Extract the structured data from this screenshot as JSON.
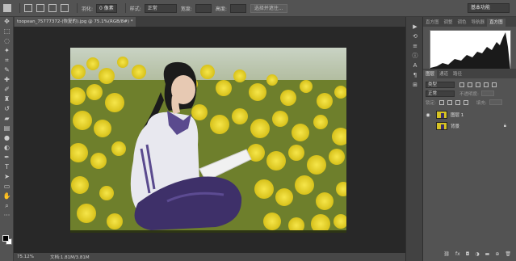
{
  "options_bar": {
    "feather_label": "羽化:",
    "feather_value": "0 像素",
    "style_label": "样式:",
    "style_value": "正常",
    "width_label": "宽度:",
    "height_label": "高度:",
    "select_mask_button": "选择并遮住...",
    "workspace": "基本功能"
  },
  "document": {
    "tab_title": "toopean_75777372-(恢复的).jpg @ 75.1%(RGB/8#) *"
  },
  "status_bar": {
    "zoom": "75.12%",
    "doc_size": "文档:1.81M/3.81M"
  },
  "panels": {
    "top_tabs": [
      "直方图",
      "调整",
      "调色",
      "导航器",
      "直方图"
    ],
    "top_active_index": 4,
    "layer_tabs": [
      "图层",
      "通道",
      "路径"
    ],
    "layer_active_index": 0,
    "kind_filter": "类型",
    "blend_mode": "正常",
    "opacity_label": "不透明度:",
    "lock_label": "锁定:",
    "fill_label": "填充:",
    "layers": [
      {
        "name": "图层 1",
        "selected": false
      },
      {
        "name": "背景",
        "selected": false
      }
    ]
  },
  "colors": {
    "canvas_bg": "#282828",
    "ui_gray": "#535353",
    "photo_yellow": "#e2cf22",
    "shirt_purple": "#4a3b74"
  },
  "icons": {
    "tools": [
      "move-icon",
      "marquee-icon",
      "lasso-icon",
      "magic-wand-icon",
      "crop-icon",
      "eyedropper-icon",
      "healing-icon",
      "brush-icon",
      "stamp-icon",
      "history-brush-icon",
      "eraser-icon",
      "gradient-icon",
      "blur-icon",
      "dodge-icon",
      "pen-icon",
      "type-icon",
      "path-select-icon",
      "shape-icon",
      "hand-icon",
      "zoom-icon",
      "more-icon"
    ]
  }
}
